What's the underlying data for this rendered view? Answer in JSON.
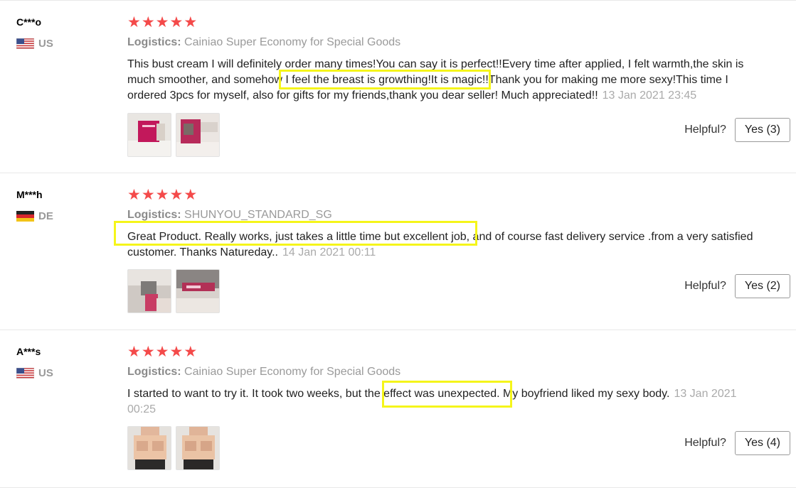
{
  "reviews": [
    {
      "user": "C***o",
      "country_code": "US",
      "flag_icon": "us-flag-icon",
      "rating": 5,
      "logistics_label": "Logistics:",
      "logistics": "Cainiao Super Economy for Special Goods",
      "text": "This bust cream I will definitely order many times!You can say it is perfect!!Every time after applied, I felt warmth,the skin is much smoother, and somehow I feel the breast is growthing!It is magic!!Thank you for making me more sexy!This time I ordered 3pcs for myself, also for gifts for my friends,thank you dear seller! Much appreciated!!",
      "date": "13 Jan 2021 23:45",
      "photos": 2,
      "helpful_label": "Helpful?",
      "yes_label": "Yes (3)"
    },
    {
      "user": "M***h",
      "country_code": "DE",
      "flag_icon": "de-flag-icon",
      "rating": 5,
      "logistics_label": "Logistics:",
      "logistics": "SHUNYOU_STANDARD_SG",
      "text": "Great Product. Really works, just takes a little time but excellent job, and of course fast delivery service .from a very satisfied customer. Thanks Natureday..",
      "date": "14 Jan 2021 00:11",
      "photos": 2,
      "helpful_label": "Helpful?",
      "yes_label": "Yes (2)"
    },
    {
      "user": "A***s",
      "country_code": "US",
      "flag_icon": "us-flag-icon",
      "rating": 5,
      "logistics_label": "Logistics:",
      "logistics": "Cainiao Super Economy for Special Goods",
      "text": "I started to want to try it. It took two weeks, but the effect was unexpected. My boyfriend liked my sexy body.",
      "date": "13 Jan 2021 00:25",
      "photos": 2,
      "helpful_label": "Helpful?",
      "yes_label": "Yes (4)"
    }
  ],
  "star_glyph": "★",
  "colors": {
    "star": "#f44a4a",
    "highlight": "#f5f51a",
    "muted_text": "#9a9a9a"
  }
}
